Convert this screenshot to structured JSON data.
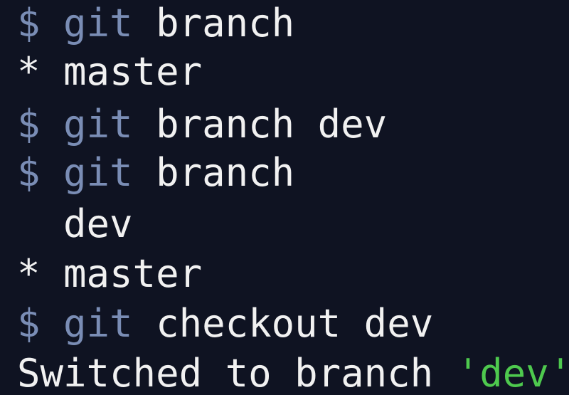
{
  "colors": {
    "background": "#0f1322",
    "prompt": "#7a8db5",
    "text": "#f1f1f1",
    "string": "#4ec94e"
  },
  "lines": [
    {
      "type": "command",
      "prompt": "$ ",
      "program": "git",
      "args": " branch"
    },
    {
      "type": "output",
      "text": "* master"
    },
    {
      "type": "command",
      "prompt": "$ ",
      "program": "git",
      "args": " branch dev"
    },
    {
      "type": "command",
      "prompt": "$ ",
      "program": "git",
      "args": " branch"
    },
    {
      "type": "output",
      "text": "  dev"
    },
    {
      "type": "output",
      "text": "* master"
    },
    {
      "type": "command",
      "prompt": "$ ",
      "program": "git",
      "args": " checkout dev"
    },
    {
      "type": "output",
      "text": "Switched to branch ",
      "quoted": "'dev'"
    }
  ]
}
